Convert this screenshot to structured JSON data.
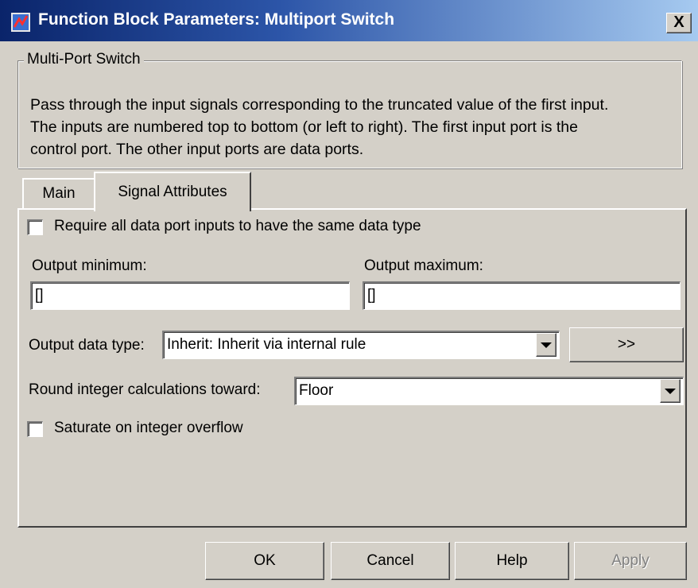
{
  "window": {
    "title": "Function Block Parameters: Multiport Switch",
    "close_label": "X"
  },
  "group": {
    "label": "Multi-Port Switch",
    "description": "Pass through the input signals corresponding to the truncated value of the first input.\nThe inputs are numbered top to bottom (or left to right). The first input port is the\ncontrol port. The other input ports are data ports."
  },
  "tabs": [
    {
      "label": "Main",
      "active": false
    },
    {
      "label": "Signal Attributes",
      "active": true
    }
  ],
  "signal_attributes": {
    "same_type_label": "Require all data port inputs to have the same data type",
    "same_type_checked": false,
    "out_min_label": "Output minimum:",
    "out_min_value": "[]",
    "out_max_label": "Output maximum:",
    "out_max_value": "[]",
    "data_type_label": "Output data type:",
    "data_type_value": "Inherit: Inherit via internal rule",
    "assistant_label": ">>",
    "round_label": "Round integer calculations toward:",
    "round_value": "Floor",
    "saturate_label": "Saturate on integer overflow",
    "saturate_checked": false
  },
  "buttons": {
    "ok": "OK",
    "cancel": "Cancel",
    "help": "Help",
    "apply": "Apply"
  }
}
